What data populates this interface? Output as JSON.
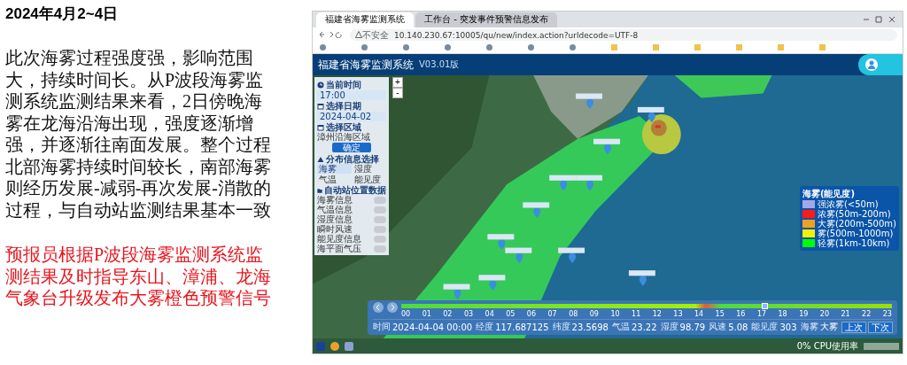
{
  "slide": {
    "title": "2024年4月2~4日",
    "paragraphs": [
      {
        "kind": "body",
        "text": "此次海雾过程强度强，影响范围大，持续时间长。从P波段海雾监测系统监测结果来看，2日傍晚海雾在龙海沿海出现，强度逐渐增强，并逐渐往南面发展。整个过程北部海雾持续时间较长，南部海雾则经历发展-减弱-再次发展-消散的过程，与自动站监测结果基本一致"
      },
      {
        "kind": "highlight",
        "text": "预报员根据P波段海雾监测系统监测结果及时指导东山、漳浦、龙海气象台升级发布大雾橙色预警信号"
      }
    ]
  },
  "browser": {
    "tabs": [
      {
        "label": "福建省海雾监测系统",
        "selected": true
      },
      {
        "label": "工作台 - 突发事件预警信息发布",
        "selected": false
      }
    ],
    "address": {
      "security": "不安全",
      "url": "10.140.230.67:10005/qu/new/index.action?urldecode=UTF-8"
    }
  },
  "app": {
    "title": "福建省海雾监测系统",
    "version": "V03.01版",
    "panel": {
      "time_label": "当前时间",
      "time": "17:00",
      "date_label": "选择日期",
      "date": "2024-04-02",
      "region_label": "选择区域",
      "region": "漳州沿海区域",
      "confirm": "确定",
      "dist_label": "分布信息选择",
      "options": [
        {
          "label": "海雾",
          "selected": true
        },
        {
          "label": "湿度",
          "selected": false
        },
        {
          "label": "气温",
          "selected": false
        },
        {
          "label": "能见度",
          "selected": false
        }
      ],
      "stations_label": "自动站位置数据",
      "toggles": [
        {
          "label": "海雾信息",
          "on": false
        },
        {
          "label": "气温信息",
          "on": false
        },
        {
          "label": "湿度信息",
          "on": false
        },
        {
          "label": "瞬时风速",
          "on": false
        },
        {
          "label": "能见度信息",
          "on": false
        },
        {
          "label": "海平面气压",
          "on": false
        }
      ]
    },
    "zoom": [
      "+",
      "-"
    ],
    "legend": {
      "title": "海雾(能见度)",
      "items": [
        {
          "label": "强浓雾(<50m)",
          "color": "#a0a8e8"
        },
        {
          "label": "浓雾(50m-200m)",
          "color": "#ff1a1a"
        },
        {
          "label": "大雾(200m-500m)",
          "color": "#f0a020"
        },
        {
          "label": "雾(500m-1000m)",
          "color": "#f0f000"
        },
        {
          "label": "轻雾(1km-10km)",
          "color": "#00ff00"
        }
      ]
    },
    "timeline": {
      "hours": [
        "00",
        "01",
        "02",
        "03",
        "04",
        "05",
        "06",
        "07",
        "08",
        "09",
        "10",
        "11",
        "12",
        "13",
        "14",
        "15",
        "16",
        "17",
        "18",
        "19",
        "20",
        "21",
        "22",
        "23"
      ],
      "level": 0.74,
      "fields": [
        {
          "label": "时间",
          "value": "2024-04-04 00:00"
        },
        {
          "label": "经度",
          "value": "117.687125"
        },
        {
          "label": "纬度",
          "value": "23.5698"
        },
        {
          "label": "气温",
          "value": "23.22"
        },
        {
          "label": "湿度",
          "value": "98.79"
        },
        {
          "label": "风速",
          "value": "5.08"
        },
        {
          "label": "能见度",
          "value": "303"
        },
        {
          "label": "海雾",
          "value": "大雾"
        }
      ],
      "buttons": [
        "上次",
        "下次"
      ]
    }
  },
  "taskbar": {
    "cpu": "0%",
    "cpu_label": "CPU使用率"
  }
}
